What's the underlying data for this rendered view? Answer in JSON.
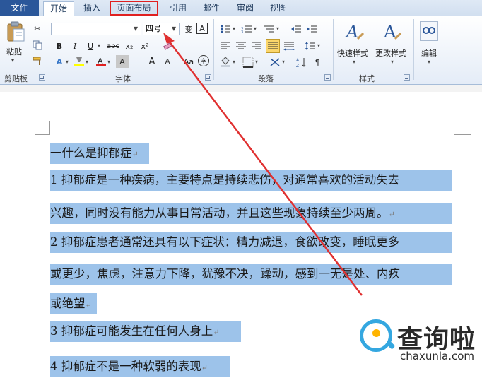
{
  "tabs": {
    "file": "文件",
    "home": "开始",
    "insert": "插入",
    "page_layout": "页面布局",
    "references": "引用",
    "mailings": "邮件",
    "review": "审阅",
    "view": "视图"
  },
  "ribbon": {
    "clipboard": {
      "paste_label": "粘贴",
      "group_label": "剪贴板"
    },
    "font": {
      "font_name_value": "",
      "font_size_value": "四号",
      "group_label": "字体",
      "grow_font": "A",
      "shrink_font": "A",
      "bold": "B",
      "italic": "I",
      "underline": "U",
      "strikethrough": "abc",
      "subscript": "x₂",
      "superscript": "x²",
      "phonetic_guide": "变",
      "char_border": "A",
      "char_shading": "A",
      "enclose_char": "字"
    },
    "paragraph": {
      "group_label": "段落"
    },
    "styles": {
      "quick_styles": "快速样式",
      "change_styles": "更改样式",
      "group_label": "样式"
    },
    "editing": {
      "label": "编辑"
    }
  },
  "document": {
    "lines": [
      "一什么是抑郁症",
      "1 抑郁症是一种疾病，主要特点是持续悲伤，对通常喜欢的活动失去",
      "兴趣，同时没有能力从事日常活动，并且这些现象持续至少两周。",
      "2 抑郁症患者通常还具有以下症状：精力减退，食欲改变，睡眠更多",
      "或更少，焦虑，注意力下降，犹豫不决，躁动，感到一无是处、内疚",
      "或绝望",
      "3 抑郁症可能发生在任何人身上",
      "4 抑郁症不是一种软弱的表现"
    ],
    "paragraph_mark": "↵"
  },
  "watermark": {
    "title": "查询啦",
    "url": "chaxunla.com"
  },
  "colors": {
    "selection": "#9dc3ea",
    "highlight_box": "#e02020",
    "arrow": "#e03030",
    "file_tab": "#2b579a"
  }
}
